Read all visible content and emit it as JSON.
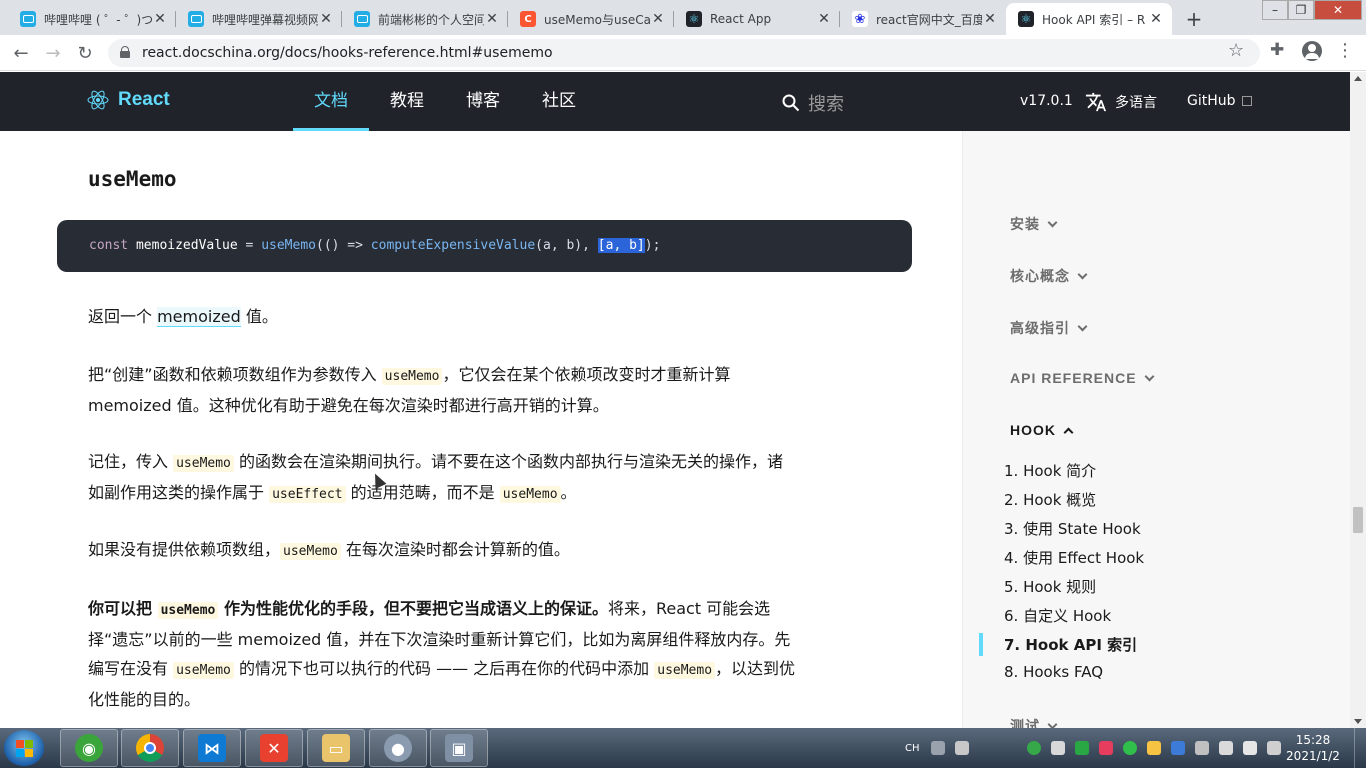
{
  "browser": {
    "tabs": [
      {
        "title": "哔哩哔哩 ( ゜- ゜)つ",
        "icon": "bilibili-icon"
      },
      {
        "title": "哔哩哔哩弹幕视频网",
        "icon": "bilibili-icon"
      },
      {
        "title": "前端彬彬的个人空间",
        "icon": "bilibili-icon"
      },
      {
        "title": "useMemo与useCallback",
        "icon": "csdn-icon"
      },
      {
        "title": "React App",
        "icon": "react-icon"
      },
      {
        "title": "react官网中文_百度",
        "icon": "baidu-icon"
      },
      {
        "title": "Hook API 索引 – R",
        "icon": "react-icon",
        "active": true
      }
    ],
    "url": "react.docschina.org/docs/hooks-reference.html#usememo"
  },
  "site": {
    "logo_text": "React",
    "nav": [
      "文档",
      "教程",
      "博客",
      "社区"
    ],
    "search_placeholder": "搜索",
    "version": "v17.0.1",
    "language": "多语言",
    "github": "GitHub"
  },
  "content": {
    "heading": "useMemo",
    "code": {
      "kw": "const",
      "var": "memoizedValue",
      "eq": " = ",
      "fn1": "useMemo",
      "p1": "(() => ",
      "fn2": "computeExpensiveValue",
      "args": "(a, b), ",
      "selected": "[a, b]",
      "end": ");"
    },
    "p1": {
      "pre": "返回一个 ",
      "link": "memoized",
      "post": " 值。"
    },
    "p2": {
      "pre": "把“创建”函数和依赖项数组作为参数传入 ",
      "code": "useMemo",
      "post": "，它仅会在某个依赖项改变时才重新计算 memoized 值。这种优化有助于避免在每次渲染时都进行高开销的计算。"
    },
    "p3": {
      "pre": "记住，传入 ",
      "code1": "useMemo",
      "mid1": " 的函数会在渲染期间执行。请不要在这个函数内部执行与渲染无关的操作，诸如副作用这类的操作属于 ",
      "code2": "useEffect",
      "mid2": " 的适用范畴，而不是 ",
      "code3": "useMemo",
      "post": "。"
    },
    "p4": {
      "pre": "如果没有提供依赖项数组，",
      "code": "useMemo",
      "post": " 在每次渲染时都会计算新的值。"
    },
    "p5": {
      "bold_pre": "你可以把 ",
      "bold_code": "useMemo",
      "bold_post": " 作为性能优化的手段，但不要把它当成语义上的保证。",
      "pre": "将来，React 可能会选择“遗忘”以前的一些 memoized 值，并在下次渲染时重新计算它们，比如为离屏组件释放内存。先编写在没有 ",
      "code1": "useMemo",
      "mid": " 的情况下也可以执行的代码 —— 之后再在你的代码中添加 ",
      "code2": "useMemo",
      "post": "，以达到优化性能的目的。"
    }
  },
  "sidebar": {
    "sections": [
      "安装",
      "核心概念",
      "高级指引",
      "API REFERENCE",
      "HOOK",
      "测试"
    ],
    "hook_items": [
      "1. Hook 简介",
      "2. Hook 概览",
      "3. 使用 State Hook",
      "4. 使用 Effect Hook",
      "5. Hook 规则",
      "6. 自定义 Hook",
      "7. Hook API 索引",
      "8. Hooks FAQ"
    ],
    "active_item": "7. Hook API 索引"
  },
  "taskbar": {
    "input_method": "CH",
    "time": "15:28",
    "date": "2021/1/2"
  },
  "colors": {
    "react_blue": "#61dafb",
    "header_bg": "#20232a",
    "code_bg": "#282c34"
  }
}
